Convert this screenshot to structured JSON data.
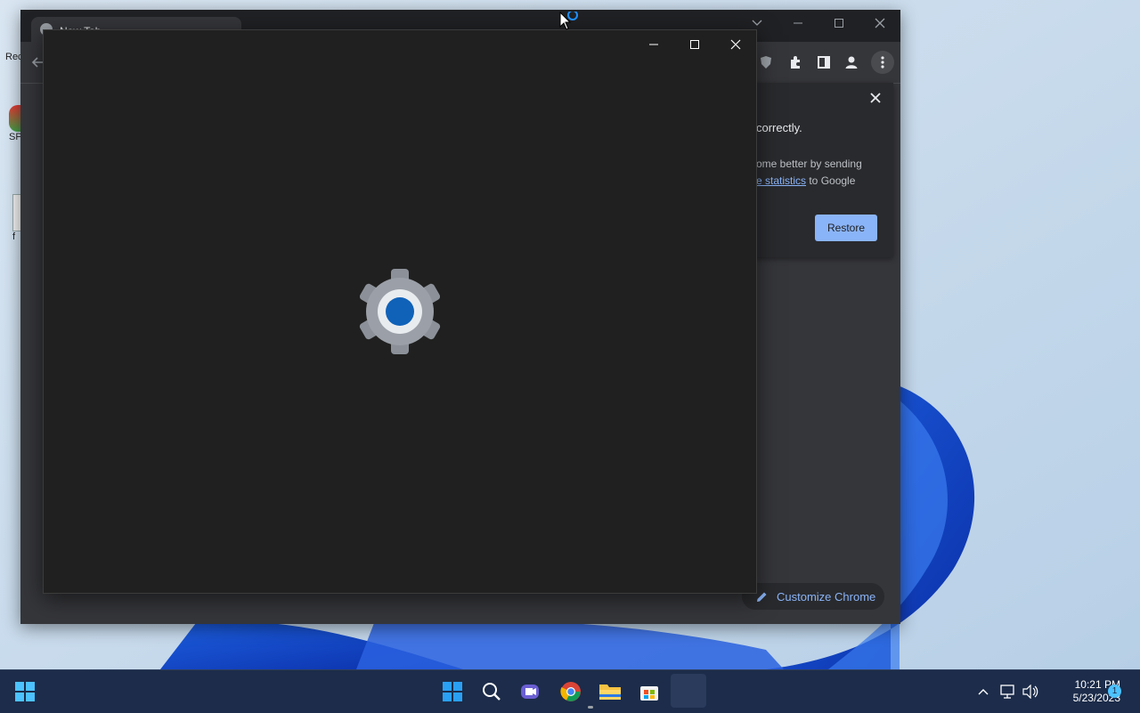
{
  "desktop": {
    "icons": [
      {
        "label": "Rec"
      },
      {
        "label": "SP"
      },
      {
        "label": "f"
      }
    ]
  },
  "chrome": {
    "tab_title": "New Tab",
    "restore_panel": {
      "heading": "correctly.",
      "text_line1": "ome better by sending",
      "link_text": "e statistics",
      "text_line2_suffix": " to Google",
      "restore_label": "Restore"
    },
    "customize_label": "Customize Chrome"
  },
  "taskbar": {
    "time": "10:21 PM",
    "date": "5/23/2023",
    "notification_count": "1"
  },
  "colors": {
    "chrome_dark": "#35363a",
    "settings_bg": "#202020",
    "accent_blue": "#8ab4f8",
    "taskbar_bg": "#1c2c4a"
  }
}
